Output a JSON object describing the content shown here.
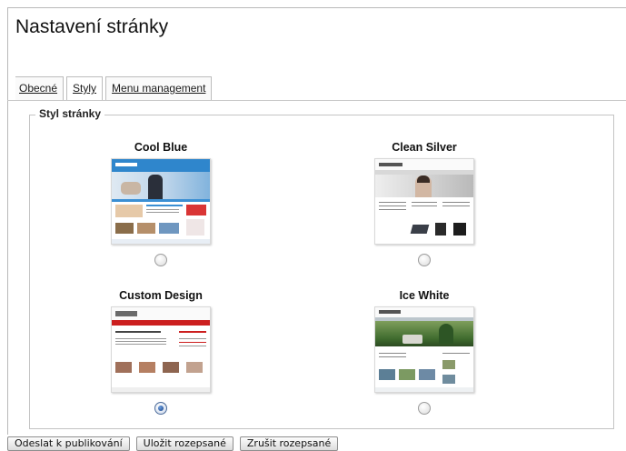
{
  "page": {
    "title": "Nastavení stránky"
  },
  "tabs": [
    {
      "label": "Obecné",
      "active": false
    },
    {
      "label": "Styly",
      "active": true
    },
    {
      "label": "Menu management",
      "active": false
    }
  ],
  "style_section": {
    "legend": "Styl stránky",
    "options": [
      {
        "name": "Cool Blue",
        "selected": false
      },
      {
        "name": "Clean Silver",
        "selected": false
      },
      {
        "name": "Custom Design",
        "selected": true
      },
      {
        "name": "Ice White",
        "selected": false
      }
    ]
  },
  "buttons": {
    "submit": "Odeslat k publikování",
    "save_draft": "Uložit rozepsané",
    "cancel_draft": "Zrušit rozepsané"
  },
  "colors": {
    "accent_selected_radio": "#123f86",
    "cool_blue_header": "#3b8fd3",
    "custom_design_bar": "#cc1f1f",
    "ice_white_nature": "#3f6b2e"
  }
}
